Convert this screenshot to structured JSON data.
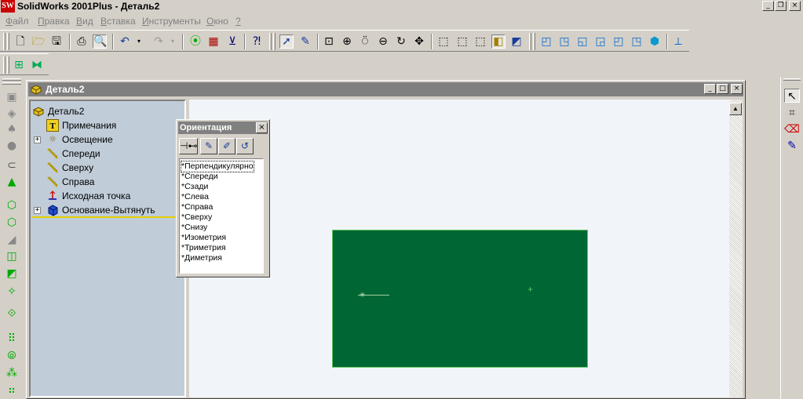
{
  "app": {
    "title": "SolidWorks 2001Plus - Деталь2",
    "logo": "SW"
  },
  "window_controls": {
    "minimize": "_",
    "restore": "❐",
    "close": "×"
  },
  "menu": [
    {
      "label": "Файл",
      "accel": "Ф",
      "rest": "айл"
    },
    {
      "label": "Правка",
      "accel": "П",
      "rest": "равка"
    },
    {
      "label": "Вид",
      "accel": "В",
      "rest": "ид"
    },
    {
      "label": "Вставка",
      "accel": "В",
      "rest": "ставка"
    },
    {
      "label": "Инструменты",
      "accel": "И",
      "rest": "нструменты"
    },
    {
      "label": "Окно",
      "accel": "О",
      "rest": "кно"
    },
    {
      "label": "?",
      "accel": "?",
      "rest": ""
    }
  ],
  "document": {
    "title": "Деталь2"
  },
  "tree": {
    "root": "Деталь2",
    "items": [
      {
        "label": "Примечания",
        "icon": "annotations-icon",
        "expandable": false
      },
      {
        "label": "Освещение",
        "icon": "lighting-icon",
        "expandable": true
      },
      {
        "label": "Спереди",
        "icon": "plane-icon",
        "expandable": false
      },
      {
        "label": "Сверху",
        "icon": "plane-icon",
        "expandable": false
      },
      {
        "label": "Справа",
        "icon": "plane-icon",
        "expandable": false
      },
      {
        "label": "Исходная точка",
        "icon": "origin-icon",
        "expandable": false
      },
      {
        "label": "Основание-Вытянуть",
        "icon": "extrude-icon",
        "expandable": true
      }
    ]
  },
  "orientation_dialog": {
    "title": "Ориентация",
    "close": "×",
    "views": [
      "*Перпендикулярно",
      "*Спереди",
      "*Сзади",
      "*Слева",
      "*Справа",
      "*Сверху",
      "*Снизу",
      "*Изометрия",
      "*Триметрия",
      "*Диметрия"
    ]
  },
  "colors": {
    "part_face": "#006633",
    "part_edge": "#5ec45e",
    "viewport_bg": "#f1f5f9",
    "tree_bg": "#c0ccd8"
  }
}
